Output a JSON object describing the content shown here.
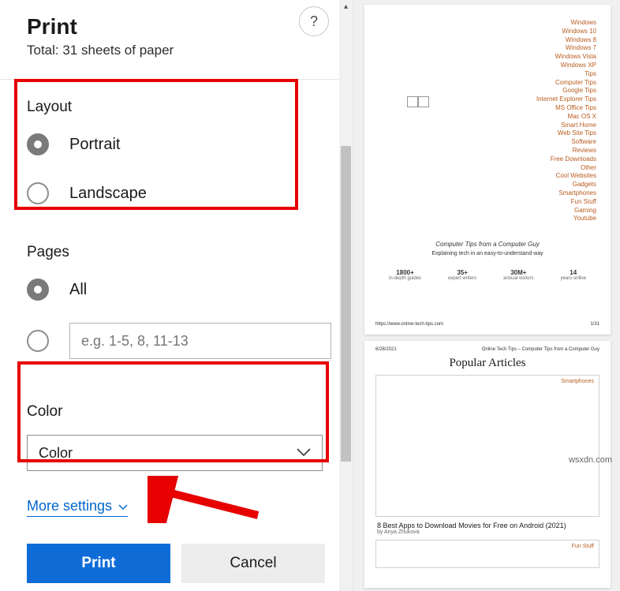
{
  "header": {
    "title": "Print",
    "total": "Total: 31 sheets of paper",
    "help": "?"
  },
  "layout": {
    "label": "Layout",
    "portrait": "Portrait",
    "landscape": "Landscape"
  },
  "pages": {
    "label": "Pages",
    "all": "All",
    "placeholder": "e.g. 1-5, 8, 11-13"
  },
  "color": {
    "label": "Color",
    "selected": "Color"
  },
  "moreSettings": "More settings",
  "buttons": {
    "print": "Print",
    "cancel": "Cancel"
  },
  "preview": {
    "page1": {
      "links": [
        "Windows",
        "Windows 10",
        "Windows 8",
        "Windows 7",
        "Windows Vista",
        "Windows XP",
        "Tips",
        "Computer Tips",
        "Google Tips",
        "Internet Explorer Tips",
        "MS Office Tips",
        "Mac OS X",
        "Smart Home",
        "Web Site Tips",
        "Software",
        "Reviews",
        "Free Downloads",
        "Other",
        "Cool Websites",
        "Gadgets",
        "Smartphones",
        "Fun Stuff",
        "Gaming",
        "Youtube"
      ],
      "tagline": "Computer Tips from a Computer Guy",
      "subtag": "Explaining tech in an easy-to-understand way",
      "stats": [
        {
          "n": "1800+",
          "l": "in-depth guides"
        },
        {
          "n": "35+",
          "l": "expert writers"
        },
        {
          "n": "30M+",
          "l": "annual visitors"
        },
        {
          "n": "14",
          "l": "years online"
        }
      ],
      "url": "https://www.online-tech-tips.com",
      "pageNum": "1/31"
    },
    "page2": {
      "date": "6/28/2021",
      "head": "Online Tech Tips – Computer Tips from a Computer Guy",
      "title": "Popular Articles",
      "tag1": "Smartphones",
      "article": "8 Best Apps to Download Movies for Free on Android (2021)",
      "author": "by Anya Zhukova",
      "tag2": "Fun Stuff"
    },
    "watermark": "wsxdn.com"
  }
}
